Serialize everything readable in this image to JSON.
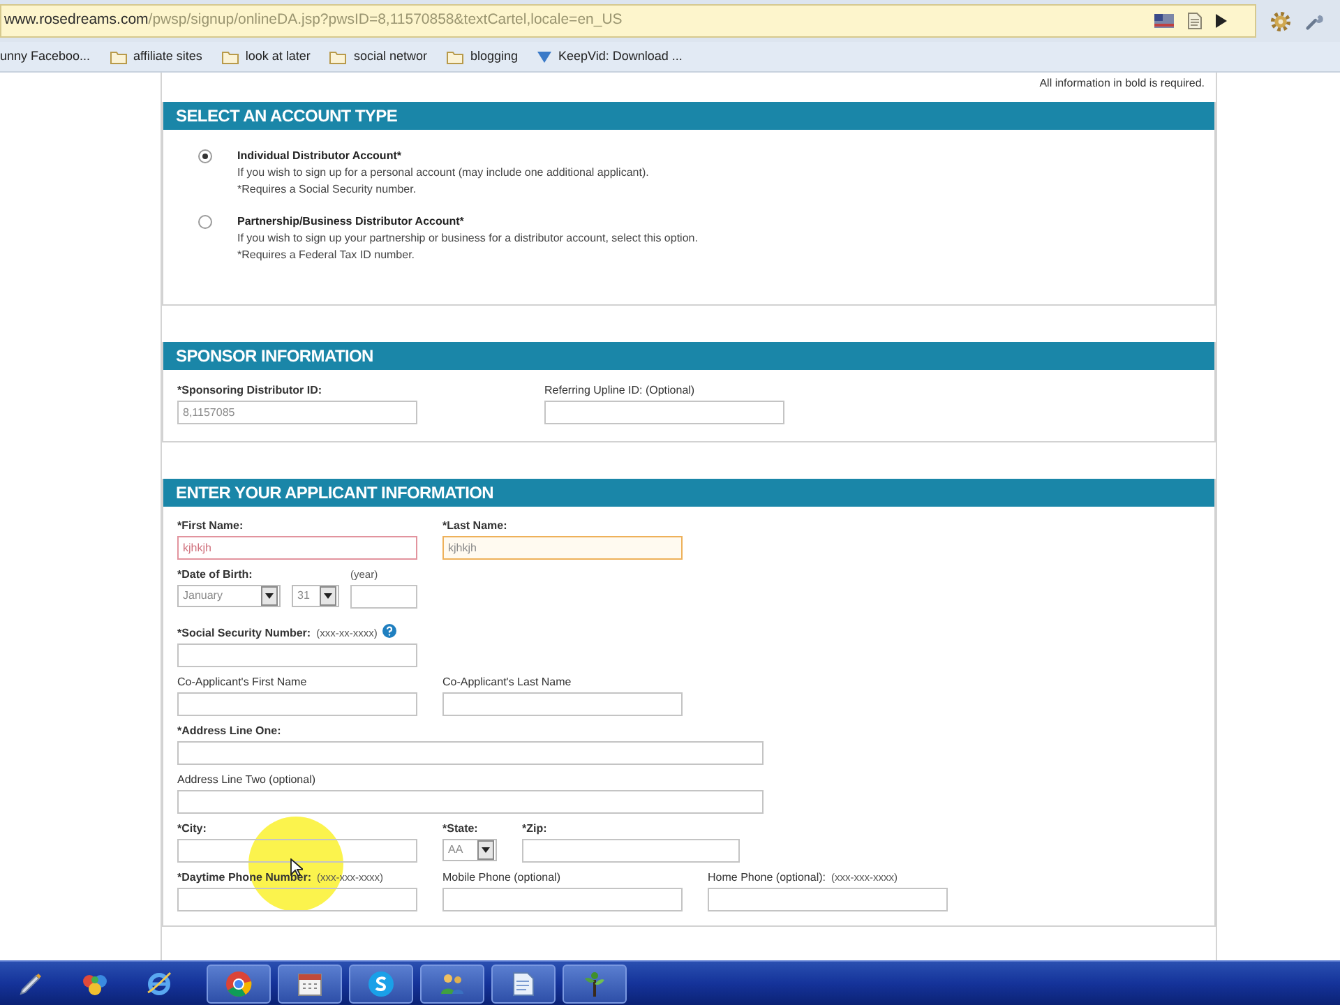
{
  "browser": {
    "address_domain": "www.rosedreams.com",
    "address_path": "/pwsp/signup/onlineDA.jsp?pwsID=8,11570858&textCartel,locale=en_US",
    "bookmarks": [
      {
        "label": "unny Faceboo...",
        "kind": "page"
      },
      {
        "label": "affiliate sites",
        "kind": "folder"
      },
      {
        "label": "look at later",
        "kind": "folder"
      },
      {
        "label": "social networ",
        "kind": "folder"
      },
      {
        "label": "blogging",
        "kind": "folder"
      },
      {
        "label": "KeepVid: Download ...",
        "kind": "link"
      }
    ]
  },
  "page": {
    "required_note": "All information in bold is required.",
    "sections": [
      {
        "kind": "account_type",
        "title": "SELECT AN ACCOUNT TYPE",
        "options": [
          {
            "title": "Individual Distributor Account*",
            "lines": [
              "If you wish to sign up for a personal account (may include one additional applicant).",
              "*Requires a Social Security number."
            ],
            "selected": true
          },
          {
            "title": "Partnership/Business Distributor Account*",
            "lines": [
              "If you wish to sign up your partnership or business for a distributor account, select this option.",
              "*Requires a Federal Tax ID number."
            ],
            "selected": false
          }
        ]
      },
      {
        "kind": "sponsor",
        "title": "SPONSOR INFORMATION",
        "rows": [
          {
            "fields": [
              {
                "kind": "text",
                "label": "*Sponsoring Distributor ID:",
                "required": true,
                "value": "8,1157085",
                "focused": false,
                "invalid": false
              },
              {
                "kind": "text",
                "label": "Referring Upline ID: (Optional)",
                "required": false,
                "focused": false,
                "invalid": false
              }
            ]
          }
        ]
      },
      {
        "kind": "applicant",
        "title": "ENTER YOUR APPLICANT INFORMATION",
        "rows": [
          {
            "fields": [
              {
                "kind": "text",
                "label": "*First Name:",
                "required": true,
                "value": "kjhkjh",
                "focused": false,
                "invalid": true
              },
              {
                "kind": "text",
                "label": "*Last Name:",
                "required": true,
                "value": "kjhkjh",
                "focused": true,
                "invalid": false
              }
            ]
          },
          {
            "fields": [
              {
                "kind": "date",
                "label": "*Date of Birth:",
                "required": true,
                "month": "January",
                "day": "31",
                "year_label": "(year)"
              }
            ]
          },
          {
            "fields": [
              {
                "kind": "text",
                "label": "*Social Security Number:",
                "hint": "(xxx-xx-xxxx)",
                "help": true,
                "required": true,
                "focused": false,
                "invalid": false
              }
            ]
          },
          {
            "fields": [
              {
                "kind": "text",
                "label": "Co-Applicant's First Name",
                "required": false,
                "focused": false,
                "invalid": false
              },
              {
                "kind": "text",
                "label": "Co-Applicant's Last Name",
                "required": false,
                "focused": false,
                "invalid": false
              }
            ]
          },
          {
            "fields": [
              {
                "kind": "longtext",
                "label": "*Address Line One:",
                "required": true,
                "focused": false,
                "invalid": false
              }
            ]
          },
          {
            "fields": [
              {
                "kind": "longtext",
                "label": "Address Line Two (optional)",
                "required": false,
                "focused": false,
                "invalid": false
              }
            ]
          },
          {
            "fields": [
              {
                "kind": "text",
                "label": "*City:",
                "required": true,
                "focused": false,
                "invalid": false
              },
              {
                "kind": "select",
                "label": "*State:",
                "required": true,
                "value": "AA"
              },
              {
                "kind": "shorttext",
                "label": "*Zip:",
                "required": true,
                "focused": false,
                "invalid": false
              }
            ]
          },
          {
            "fields": [
              {
                "kind": "text",
                "label": "*Daytime Phone Number:",
                "hint": "(xxx-xxx-xxxx)",
                "required": true,
                "focused": false,
                "invalid": false
              },
              {
                "kind": "text",
                "label": "Mobile Phone (optional)",
                "required": false,
                "focused": false,
                "invalid": false
              },
              {
                "kind": "text",
                "label": "Home Phone (optional):",
                "hint": "(xxx-xxx-xxxx)",
                "required": false,
                "focused": false,
                "invalid": false
              }
            ]
          }
        ]
      }
    ]
  }
}
